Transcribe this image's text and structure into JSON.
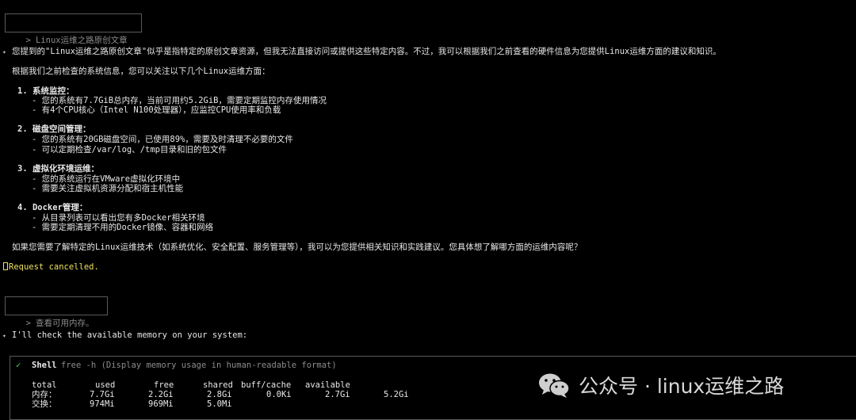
{
  "prompt1": {
    "arrow": ">",
    "text": "Linux运维之路原创文章"
  },
  "reply1": {
    "intro": "您提到的\"Linux运维之路原创文章\"似乎是指特定的原创文章资源，但我无法直接访问或提供这些特定内容。不过，我可以根据我们之前查看的硬件信息为您提供Linux运维方面的建议和知识。",
    "lead": "根据我们之前检查的系统信息，您可以关注以下几个Linux运维方面：",
    "sections": [
      {
        "title": "1. 系统监控：",
        "items": [
          "- 您的系统有7.7GiB总内存，当前可用约5.2GiB，需要定期监控内存使用情况",
          "- 有4个CPU核心（Intel N100处理器），应监控CPU使用率和负载"
        ]
      },
      {
        "title": "2. 磁盘空间管理：",
        "items": [
          "- 您的系统有20GB磁盘空间，已使用89%，需要及时清理不必要的文件",
          "- 可以定期检查/var/log、/tmp目录和旧的包文件"
        ]
      },
      {
        "title": "3. 虚拟化环境运维：",
        "items": [
          "- 您的系统运行在VMware虚拟化环境中",
          "- 需要关注虚拟机资源分配和宿主机性能"
        ]
      },
      {
        "title": "4. Docker管理：",
        "items": [
          "- 从目录列表可以看出您有多Docker相关环境",
          "- 需要定期清理不用的Docker镜像、容器和网络"
        ]
      }
    ],
    "outro": "如果您需要了解特定的Linux运维技术（如系统优化、安全配置、服务管理等），我可以为您提供相关知识和实践建议。您具体想了解哪方面的运维内容呢？"
  },
  "cancelled": "Request cancelled.",
  "prompt2": {
    "arrow": ">",
    "text": "查看可用内存。"
  },
  "reply2": {
    "text": "I'll check the available memory on your system:"
  },
  "shell": {
    "check": "✓",
    "name": "Shell",
    "command": "free -h (Display memory usage in human-readable format)",
    "headers": [
      "total",
      "used",
      "free",
      "shared",
      "buff/cache",
      "available"
    ],
    "rows": [
      {
        "label": "内存：",
        "values": [
          "7.7Gi",
          "2.2Gi",
          "2.8Gi",
          "0.0Ki",
          "2.7Gi",
          "5.2Gi"
        ]
      },
      {
        "label": "交换：",
        "values": [
          "974Mi",
          "969Mi",
          "5.0Mi",
          "",
          "",
          ""
        ]
      }
    ]
  },
  "watermark": {
    "text": "公众号 · linux运维之路"
  },
  "colors": {
    "background": "#000000",
    "text": "#e8e8e8",
    "muted": "#8c8c8c",
    "warning": "#f0e060",
    "success": "#5fd75f",
    "border": "#5a5a5a"
  },
  "icons": {
    "bullet": "small-dot-icon",
    "cursor": "cursor-block-icon",
    "check": "check-icon",
    "watermark": "wechat-icon"
  }
}
